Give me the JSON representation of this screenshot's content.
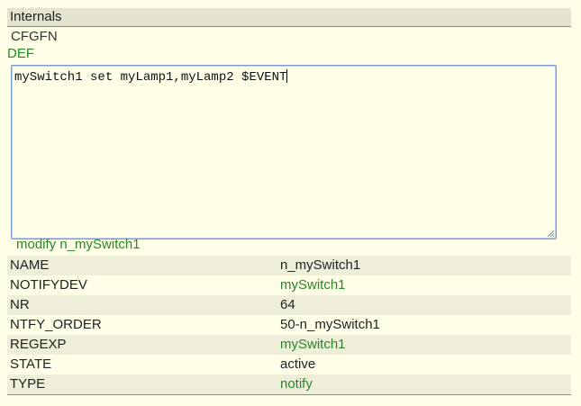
{
  "header": {
    "title": "Internals"
  },
  "cfgfn": {
    "label": "CFGFN"
  },
  "def": {
    "link_label": "DEF",
    "editor_text": "mySwitch1 set myLamp1,myLamp2 $EVENT"
  },
  "modify": {
    "label": "modify n_mySwitch1"
  },
  "internals": [
    {
      "key": "NAME",
      "value": "n_mySwitch1",
      "is_link": false
    },
    {
      "key": "NOTIFYDEV",
      "value": "mySwitch1",
      "is_link": true
    },
    {
      "key": "NR",
      "value": "64",
      "is_link": false
    },
    {
      "key": "NTFY_ORDER",
      "value": "50-n_mySwitch1",
      "is_link": false
    },
    {
      "key": "REGEXP",
      "value": "mySwitch1",
      "is_link": true
    },
    {
      "key": "STATE",
      "value": "active",
      "is_link": false
    },
    {
      "key": "TYPE",
      "value": "notify",
      "is_link": true
    }
  ],
  "colors": {
    "page_background": "#ffffe7",
    "header_background": "#e4e4cf",
    "row_alt_background": "#eeeed9",
    "link": "#278727",
    "editor_border": "#7a9ad8"
  }
}
